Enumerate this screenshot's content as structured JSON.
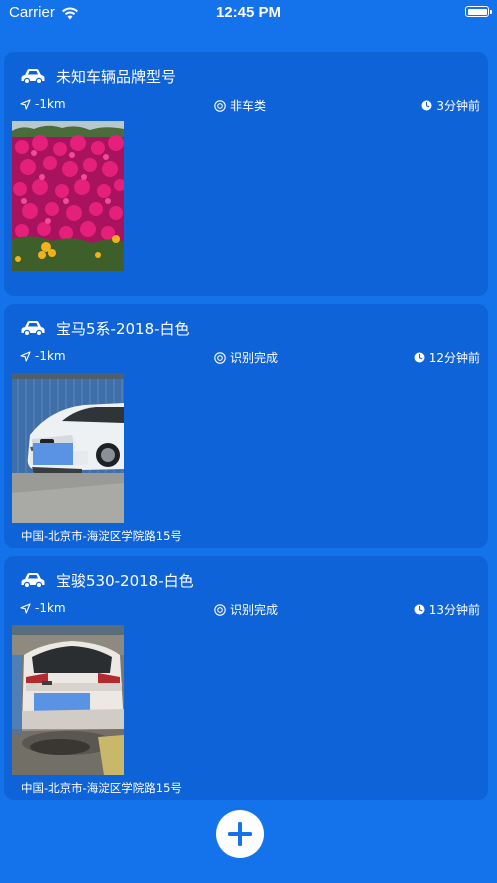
{
  "status_bar": {
    "carrier": "Carrier",
    "time": "12:45 PM"
  },
  "cards": [
    {
      "title": "未知车辆品牌型号",
      "distance": "-1km",
      "status": "非车类",
      "time": "3分钟前",
      "photo_icon": "flower-photo",
      "address": ""
    },
    {
      "title": "宝马5系-2018-白色",
      "distance": "-1km",
      "status": "识别完成",
      "time": "12分钟前",
      "photo_icon": "white-sedan-photo",
      "address": "中国-北京市-海淀区学院路15号"
    },
    {
      "title": "宝骏530-2018-白色",
      "distance": "-1km",
      "status": "识别完成",
      "time": "13分钟前",
      "photo_icon": "white-suv-photo",
      "address": "中国-北京市-海淀区学院路15号"
    }
  ],
  "colors": {
    "background": "#1472ea",
    "card": "#0f63d9",
    "text": "#ffffff",
    "accent": "#1472ea"
  },
  "icons": {
    "car": "car-icon",
    "distance": "location-arrow-icon",
    "status": "target-icon",
    "time": "clock-icon",
    "add": "plus-icon",
    "wifi": "wifi-icon",
    "battery": "battery-icon"
  }
}
